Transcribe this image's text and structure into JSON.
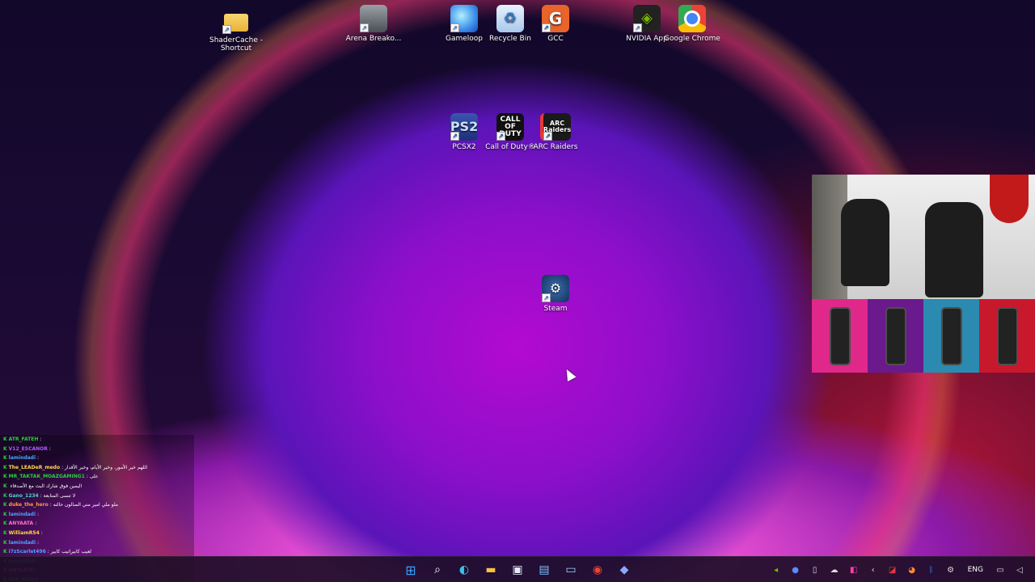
{
  "desktop": {
    "icons": [
      {
        "label": "ShaderCache - Shortcut",
        "icon": "folder-icon"
      },
      {
        "label": "Arena Breako...",
        "icon": "arena-breakout-icon"
      },
      {
        "label": "Gameloop",
        "icon": "gameloop-icon"
      },
      {
        "label": "Recycle Bin",
        "icon": "recycle-bin-icon"
      },
      {
        "label": "GCC",
        "icon": "gcc-icon"
      },
      {
        "label": "NVIDIA App",
        "icon": "nvidia-icon"
      },
      {
        "label": "Google Chrome",
        "icon": "chrome-icon"
      },
      {
        "label": "PCSX2",
        "icon": "pcsx2-icon"
      },
      {
        "label": "Call of Duty®",
        "icon": "call-of-duty-icon"
      },
      {
        "label": "ARC Raiders",
        "icon": "arc-raiders-icon"
      },
      {
        "label": "Steam",
        "icon": "steam-icon"
      }
    ],
    "icon_text": {
      "pcsx2": "PS2",
      "cod": "CALL OF DUTY",
      "arc": "ARC Raiders",
      "gcc": "G"
    }
  },
  "chat": {
    "lines": [
      {
        "user": "ATR_FATEH",
        "msg": ":",
        "color": "#2ecc40"
      },
      {
        "user": "V12_ESCANOR",
        "msg": ":",
        "color": "#b05cff"
      },
      {
        "user": "lamindadi",
        "msg": ":",
        "color": "#4aa3ff"
      },
      {
        "user": "The_LEADeR_medo",
        "msg": ": اللهم خير الأمور، وخير الأيام، وخير الأقدار",
        "color": "#ffd84a"
      },
      {
        "user": "MR_TAKTAK_MOAZGAMING1",
        "msg": ": على",
        "color": "#2ecc40"
      },
      {
        "user": "",
        "msg": "اليمين فوق شارك البث مع الأصدقاء",
        "color": "#ffffff"
      },
      {
        "user": "Gano_1234",
        "msg": ": لا تنسى المتابعة",
        "color": "#4ad6c8"
      },
      {
        "user": "duke_the_hero",
        "msg": ": ملو ملي امير مني الصالون حالته",
        "color": "#ff9a3c"
      },
      {
        "user": "lamindadi",
        "msg": ":",
        "color": "#4aa3ff"
      },
      {
        "user": "ANYAATA",
        "msg": ":",
        "color": "#ff6fcf"
      },
      {
        "user": "WilliamR54",
        "msg": ":",
        "color": "#ffd84a"
      },
      {
        "user": "lamindadi",
        "msg": ":",
        "color": "#4aa3ff"
      },
      {
        "user": "i7zScarlet496",
        "msg": ": لعيب كابيراتيب كابير",
        "color": "#4aa3ff"
      },
      {
        "user": "lamindadi",
        "msg": ":",
        "color": "#4aa3ff"
      },
      {
        "user": "ANYAATA",
        "msg": ":",
        "color": "#ff6fcf"
      },
      {
        "user": "ATR_FATEH",
        "msg": ":",
        "color": "#2ecc40"
      }
    ],
    "k_badge": "K"
  },
  "taskbar": {
    "pinned": [
      "windows-start-icon",
      "search-icon",
      "edge-icon",
      "file-explorer-icon",
      "store-icon",
      "photos-icon",
      "screenshot-icon",
      "chrome-icon",
      "pcsx2-icon"
    ],
    "language": "ENG"
  },
  "webcam": {
    "cans": [
      "pink",
      "purple",
      "blue",
      "red"
    ]
  }
}
